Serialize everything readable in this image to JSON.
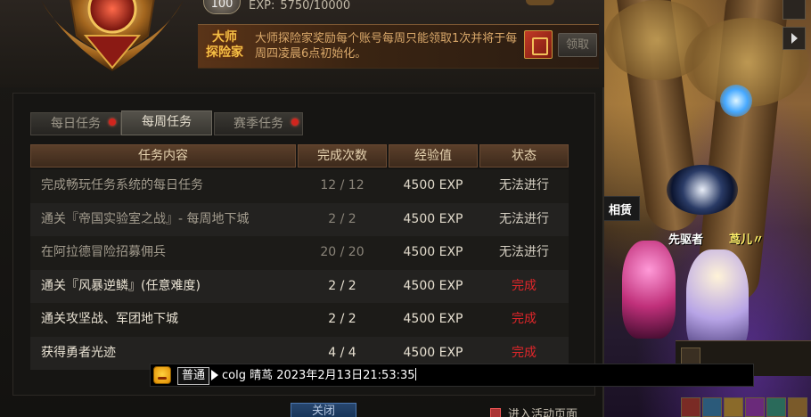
{
  "header": {
    "level": "100",
    "exp_label": "EXP:",
    "exp_value": "5750/10000"
  },
  "banner": {
    "title_line1": "大师",
    "title_line2": "探险家",
    "text": "大师探险家奖励每个账号每周只能领取1次并将于每周四凌晨6点初始化。",
    "claim_label": "领取"
  },
  "tabs": [
    {
      "label": "每日任务",
      "active": false,
      "alert": true
    },
    {
      "label": "每周任务",
      "active": true,
      "alert": false
    },
    {
      "label": "赛季任务",
      "active": false,
      "alert": true
    }
  ],
  "table": {
    "headers": [
      "任务内容",
      "完成次数",
      "经验值",
      "状态"
    ],
    "rows": [
      {
        "name": "完成畅玩任务系统的每日任务",
        "count": "12 / 12",
        "exp": "4500 EXP",
        "status": "无法进行",
        "done": false
      },
      {
        "name": "通关『帝国实验室之战』- 每周地下城",
        "count": "2 / 2",
        "exp": "4500 EXP",
        "status": "无法进行",
        "done": false
      },
      {
        "name": "在阿拉德冒险招募佣兵",
        "count": "20 / 20",
        "exp": "4500 EXP",
        "status": "无法进行",
        "done": false
      },
      {
        "name": "通关『风暴逆鳞』(任意难度)",
        "count": "2 / 2",
        "exp": "4500 EXP",
        "status": "完成",
        "done": true
      },
      {
        "name": "通关攻坚战、军团地下城",
        "count": "2 / 2",
        "exp": "4500 EXP",
        "status": "完成",
        "done": true
      },
      {
        "name": "获得勇者光迹",
        "count": "4 / 4",
        "exp": "4500 EXP",
        "status": "完成",
        "done": true
      }
    ]
  },
  "footer": {
    "close_label": "关闭",
    "activity_label": "进入活动页面"
  },
  "chat": {
    "channel": "普通",
    "input_value": "colg 晴茑 2023年2月13日21:53:35"
  },
  "scene": {
    "label_rent": "相赁",
    "player_name_1": "先驱者",
    "player_name_2": "茑儿〃"
  },
  "colors": {
    "done_status": "#e0262a",
    "banner_title": "#f4c046",
    "table_header": "#5b3f2a"
  }
}
